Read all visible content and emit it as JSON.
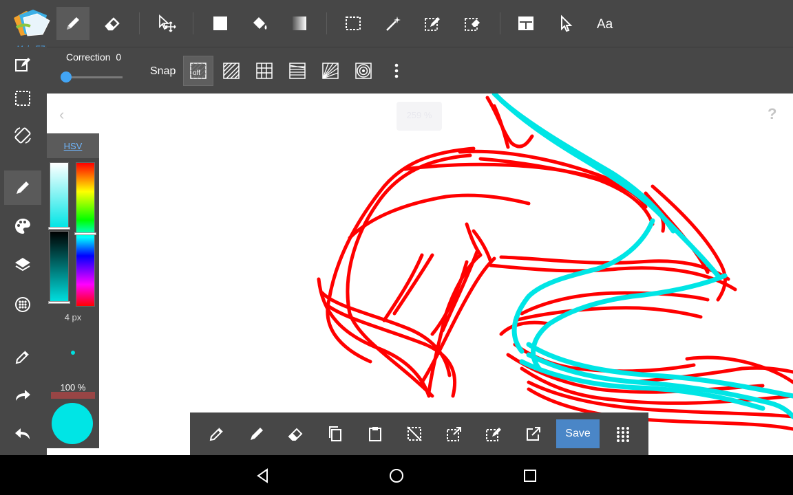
{
  "app": {
    "logo_text": "MakeEZ"
  },
  "sub_toolbar": {
    "correction_label": "Correction",
    "correction_value": "0",
    "snap_label": "Snap",
    "snap_off_label": "off"
  },
  "canvas": {
    "collapse_glyph": "‹",
    "zoom_text": "259 %",
    "help_glyph": "?"
  },
  "color_panel": {
    "mode_tab": "HSV",
    "brush_size": "4 px",
    "opacity": "100 %",
    "current_color": "#00e5e5"
  },
  "action_bar": {
    "save_label": "Save"
  },
  "colors": {
    "toolbar_bg": "#474747",
    "accent": "#4a86c7",
    "stroke_red": "#ff0000",
    "stroke_cyan": "#00e5e5"
  }
}
